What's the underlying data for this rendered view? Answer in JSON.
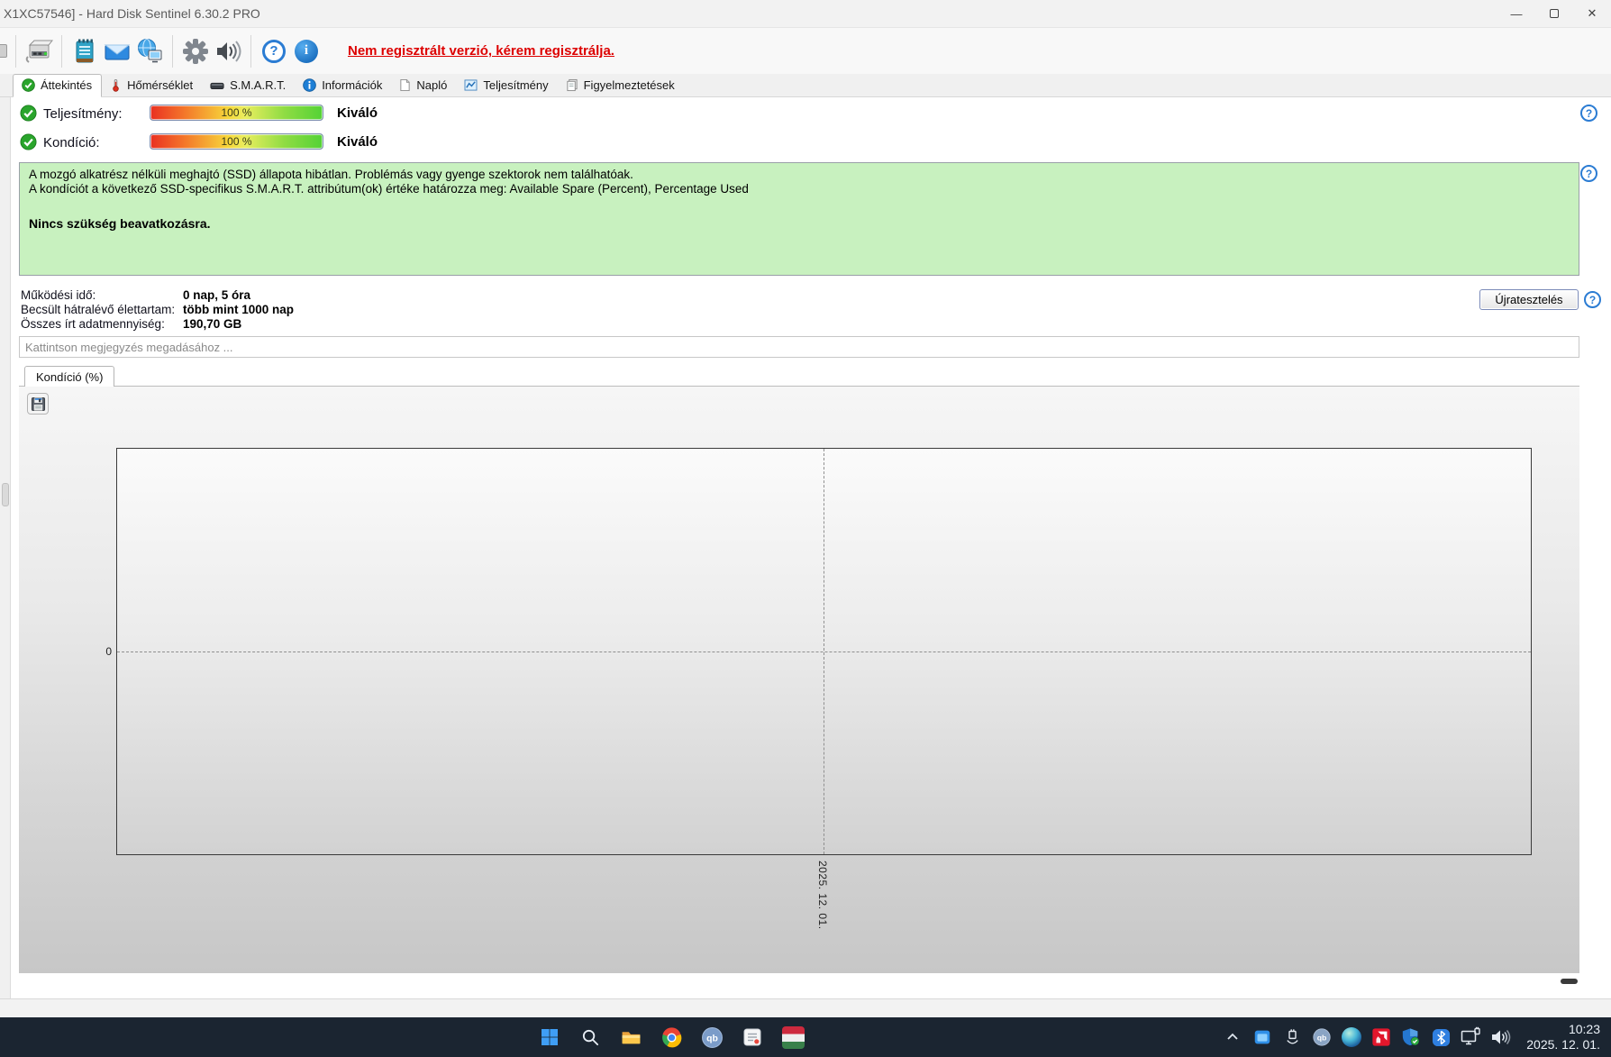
{
  "window": {
    "title": "X1XC57546]  -  Hard Disk Sentinel 6.30.2 PRO"
  },
  "icons": {
    "help_glyph": "?",
    "info_glyph": "i",
    "minimize_glyph": "—",
    "close_glyph": "✕",
    "qb_label": "qb"
  },
  "toolbar": {
    "notice": "Nem regisztrált verzió, kérem regisztrálja."
  },
  "tabs": [
    {
      "label": "Áttekintés"
    },
    {
      "label": "Hőmérséklet"
    },
    {
      "label": "S.M.A.R.T."
    },
    {
      "label": "Információk"
    },
    {
      "label": "Napló"
    },
    {
      "label": "Teljesítmény"
    },
    {
      "label": "Figyelmeztetések"
    }
  ],
  "status_rows": [
    {
      "label": "Teljesítmény:",
      "value": "100 %",
      "rating": "Kiváló"
    },
    {
      "label": "Kondíció:",
      "value": "100 %",
      "rating": "Kiváló"
    }
  ],
  "message_box": {
    "line1": "A mozgó alkatrész nélküli meghajtó (SSD) állapota hibátlan. Problémás vagy gyenge szektorok nem találhatóak.",
    "line2": "A kondíciót a következő SSD-specifikus S.M.A.R.T. attribútum(ok) értéke határozza meg:  Available Spare (Percent), Percentage Used",
    "advice": "Nincs szükség beavatkozásra."
  },
  "info_rows": [
    {
      "label": "Működési idő:",
      "value": "0 nap, 5 óra"
    },
    {
      "label": "Becsült hátralévő élettartam:",
      "value": "több mint 1000 nap"
    },
    {
      "label": "Összes írt adatmennyiség:",
      "value": "190,70 GB"
    }
  ],
  "buttons": {
    "retest": "Újratesztelés"
  },
  "comment": {
    "placeholder": "Kattintson megjegyzés megadásához ..."
  },
  "graph": {
    "tab_label": "Kondíció  (%)",
    "y_tick": "0",
    "x_tick": "2025. 12. 01."
  },
  "taskbar": {
    "time": "10:23",
    "date": "2025. 12. 01."
  },
  "colors": {
    "accent_blue": "#2b7cd3",
    "alert_red": "#dd0000",
    "ok_green": "#2aa52c",
    "message_bg": "#c8f1bf",
    "taskbar_bg": "#1b2531"
  }
}
